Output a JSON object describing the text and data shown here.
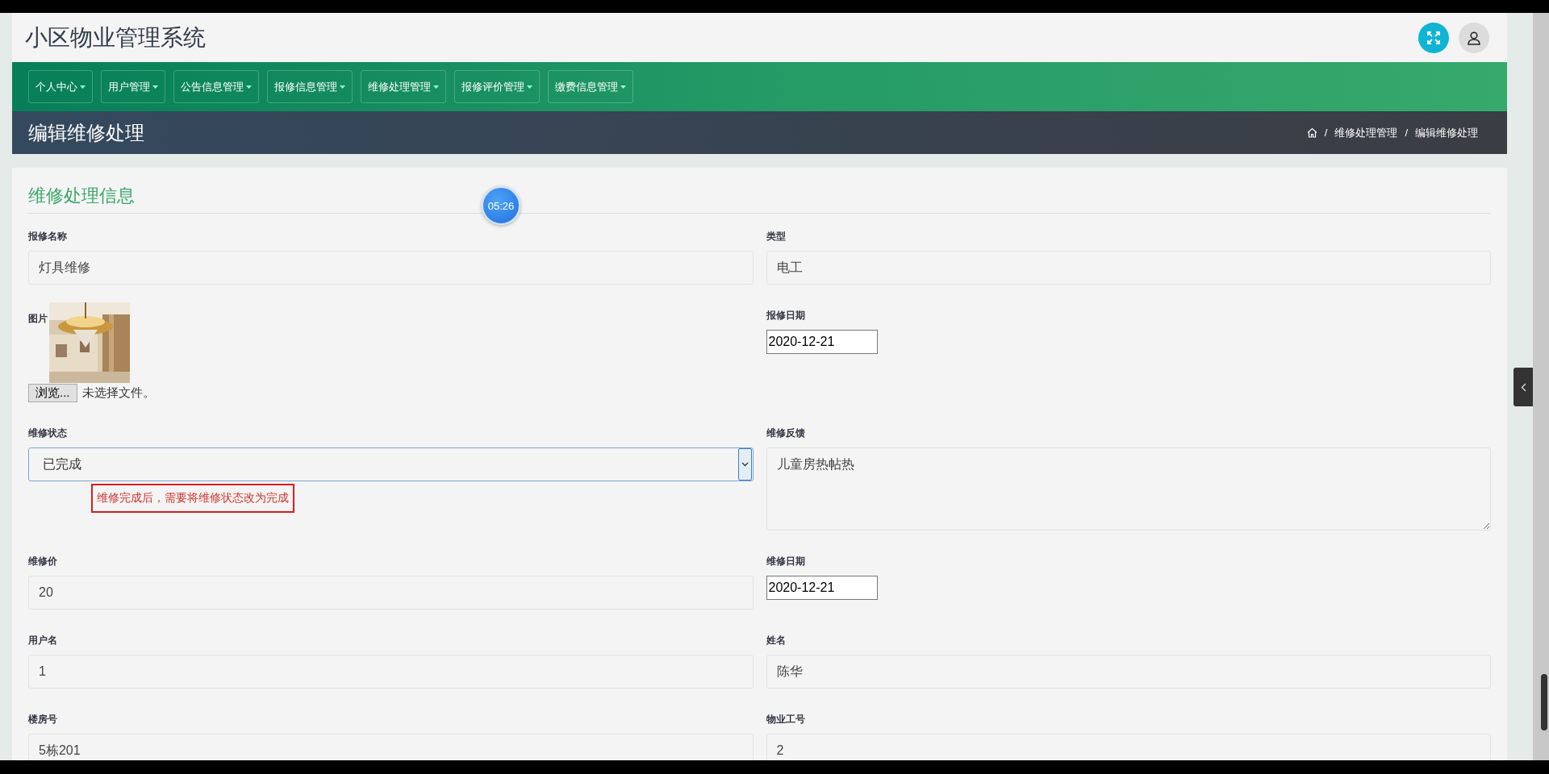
{
  "header": {
    "title": "小区物业管理系统"
  },
  "nav": [
    {
      "label": "个人中心"
    },
    {
      "label": "用户管理"
    },
    {
      "label": "公告信息管理"
    },
    {
      "label": "报修信息管理"
    },
    {
      "label": "维修处理管理"
    },
    {
      "label": "报修评价管理"
    },
    {
      "label": "缴费信息管理"
    }
  ],
  "page_title": "编辑维修处理",
  "breadcrumb": [
    "维修处理管理",
    "编辑维修处理"
  ],
  "breadcrumb_separator": "/",
  "timer": "05:26",
  "section_title": "维修处理信息",
  "fields": [
    {
      "kind": "text",
      "label": "报修名称",
      "value": "灯具维修"
    },
    {
      "kind": "text",
      "label": "类型",
      "value": "电工"
    },
    {
      "label": "图片",
      "button": "浏览...",
      "file_status": "未选择文件。"
    },
    {
      "kind": "date",
      "label": "报修日期",
      "value": "2020-12-21"
    },
    {
      "kind": "select",
      "label": "维修状态",
      "value": "已完成",
      "note": "维修完成后，需要将维修状态改为完成"
    },
    {
      "kind": "textarea",
      "label": "维修反馈",
      "value": "儿童房热帖热"
    },
    {
      "kind": "text",
      "label": "维修价",
      "value": "20"
    },
    {
      "kind": "date",
      "label": "维修日期",
      "value": "2020-12-21"
    },
    {
      "kind": "text",
      "label": "用户名",
      "value": "1"
    },
    {
      "kind": "text",
      "label": "姓名",
      "value": "陈华"
    },
    {
      "kind": "text",
      "label": "楼房号",
      "value": "5栋201"
    },
    {
      "kind": "text",
      "label": "物业工号",
      "value": "2"
    }
  ]
}
